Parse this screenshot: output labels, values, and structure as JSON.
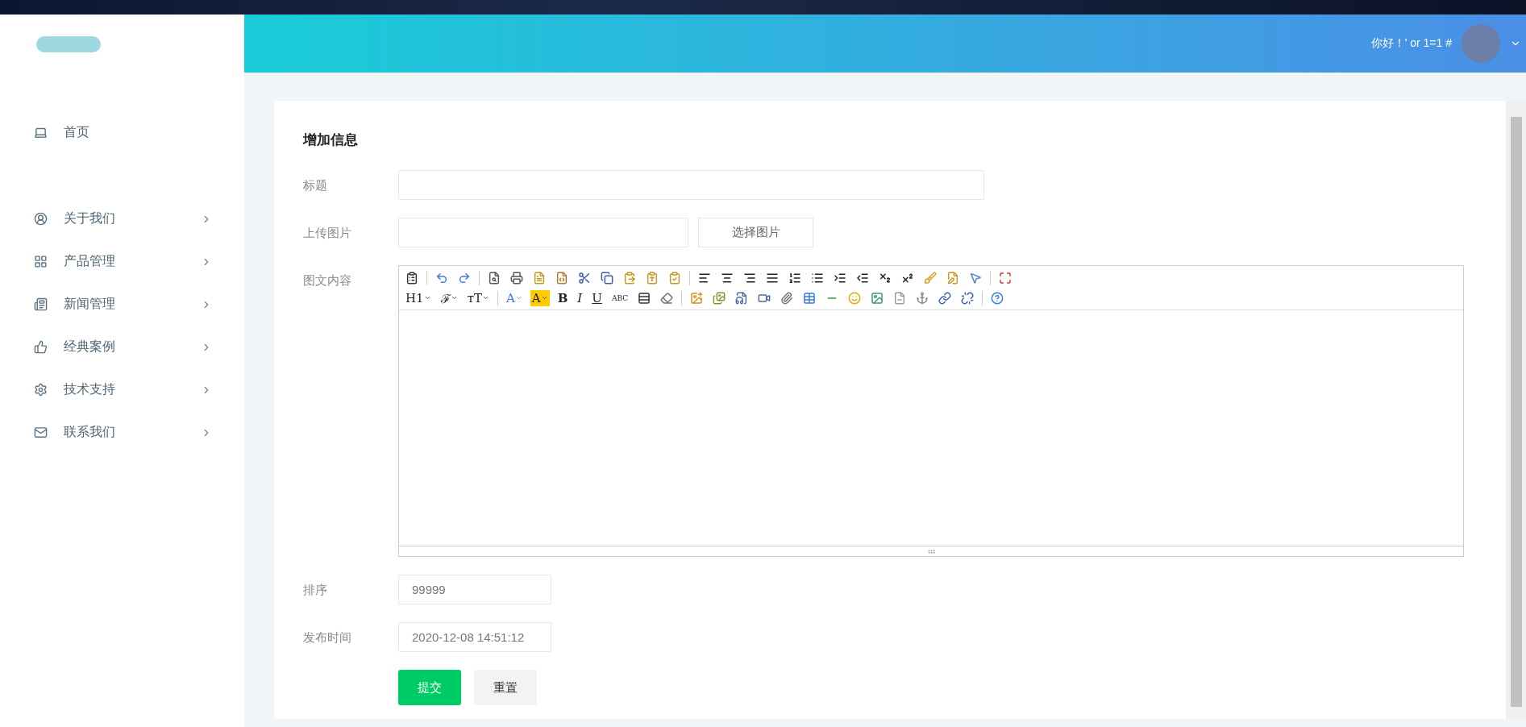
{
  "header": {
    "greeting": "你好！' or 1=1 #"
  },
  "sidebar": {
    "items": [
      {
        "label": "首页",
        "kind": "link"
      },
      {
        "label": "关于我们",
        "kind": "submenu"
      },
      {
        "label": "产品管理",
        "kind": "submenu"
      },
      {
        "label": "新闻管理",
        "kind": "submenu"
      },
      {
        "label": "经典案例",
        "kind": "submenu"
      },
      {
        "label": "技术支持",
        "kind": "submenu"
      },
      {
        "label": "联系我们",
        "kind": "submenu"
      }
    ]
  },
  "form": {
    "title": "增加信息",
    "fields": [
      {
        "label": "标题",
        "kind": "text"
      },
      {
        "label": "上传图片",
        "kind": "upload",
        "button": "选择图片"
      },
      {
        "label": "图文内容",
        "kind": "editor"
      },
      {
        "label": "排序",
        "kind": "text",
        "value": "99999"
      },
      {
        "label": "发布时间",
        "kind": "text",
        "value": "2020-12-08 14:51:12"
      }
    ],
    "toolbar": [
      [
        {
          "kind": "icon"
        },
        {
          "kind": "sep"
        },
        {
          "kind": "icon"
        },
        {
          "kind": "icon"
        },
        {
          "kind": "sep"
        },
        {
          "kind": "icon"
        },
        {
          "kind": "icon"
        },
        {
          "kind": "icon"
        },
        {
          "kind": "icon"
        },
        {
          "kind": "icon"
        },
        {
          "kind": "icon"
        },
        {
          "kind": "icon"
        },
        {
          "kind": "icon"
        },
        {
          "kind": "icon"
        },
        {
          "kind": "sep"
        },
        {
          "kind": "icon"
        },
        {
          "kind": "icon"
        },
        {
          "kind": "icon"
        },
        {
          "kind": "icon"
        },
        {
          "kind": "icon"
        },
        {
          "kind": "icon"
        },
        {
          "kind": "icon"
        },
        {
          "kind": "icon"
        },
        {
          "kind": "icon"
        },
        {
          "kind": "icon"
        },
        {
          "kind": "icon"
        },
        {
          "kind": "icon"
        },
        {
          "kind": "icon"
        },
        {
          "kind": "sep"
        },
        {
          "kind": "icon"
        }
      ],
      [
        {
          "kind": "dropdown",
          "label": "H1"
        },
        {
          "kind": "dropdown",
          "label": "ℱ"
        },
        {
          "kind": "dropdown",
          "label": "ᴛT"
        },
        {
          "kind": "sep"
        },
        {
          "kind": "dropdown",
          "label": "A"
        },
        {
          "kind": "dropdown",
          "label": "A",
          "highlight": true
        },
        {
          "kind": "text",
          "label": "B"
        },
        {
          "kind": "text",
          "label": "I"
        },
        {
          "kind": "text",
          "label": "U"
        },
        {
          "kind": "text",
          "label": "ABC"
        },
        {
          "kind": "icon"
        },
        {
          "kind": "icon"
        },
        {
          "kind": "sep"
        },
        {
          "kind": "icon"
        },
        {
          "kind": "icon"
        },
        {
          "kind": "icon"
        },
        {
          "kind": "icon"
        },
        {
          "kind": "icon"
        },
        {
          "kind": "icon"
        },
        {
          "kind": "icon"
        },
        {
          "kind": "icon"
        },
        {
          "kind": "icon"
        },
        {
          "kind": "icon"
        },
        {
          "kind": "icon"
        },
        {
          "kind": "icon"
        },
        {
          "kind": "icon"
        },
        {
          "kind": "sep"
        },
        {
          "kind": "icon"
        }
      ]
    ],
    "buttons": [
      {
        "label": "提交",
        "kind": "primary"
      },
      {
        "label": "重置",
        "kind": "secondary"
      }
    ]
  }
}
